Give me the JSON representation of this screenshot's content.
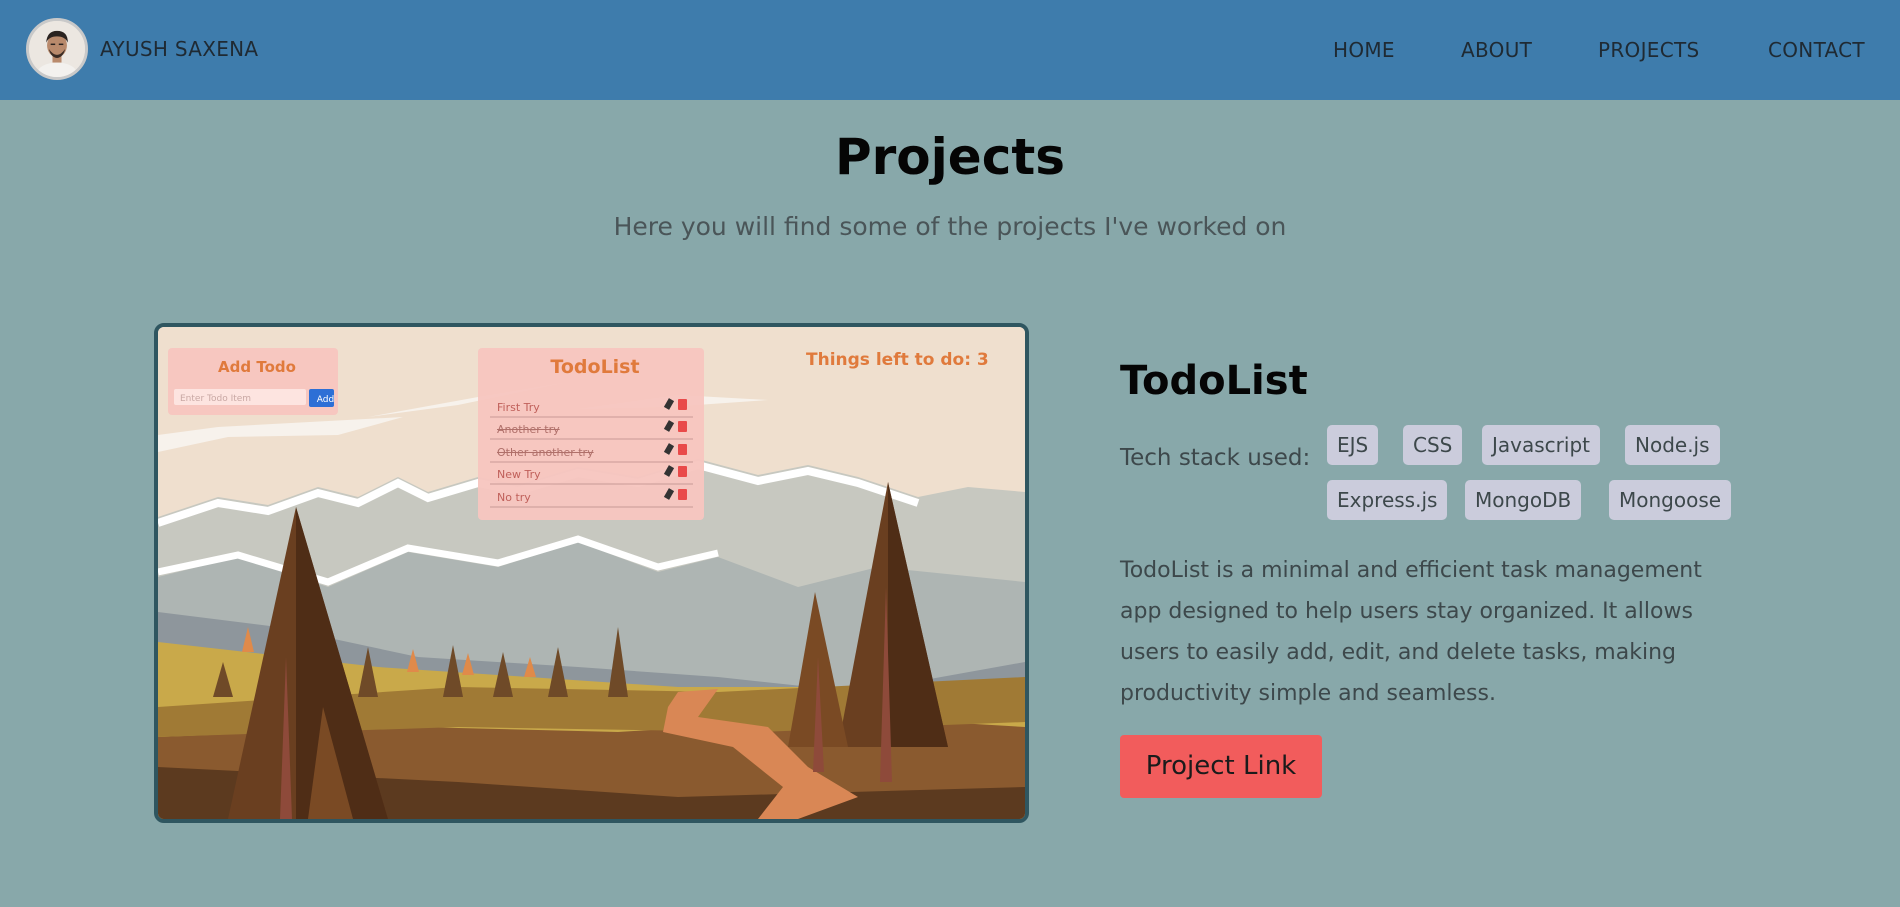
{
  "nav": {
    "brand": "AYUSH SAXENA",
    "links": [
      "HOME",
      "ABOUT",
      "PROJECTS",
      "CONTACT"
    ]
  },
  "page": {
    "title": "Projects",
    "subtitle": "Here you will find some of the projects I've worked on"
  },
  "project": {
    "title": "TodoList",
    "tech_label": "Tech stack used:",
    "tech": [
      "EJS",
      "CSS",
      "Javascript",
      "Node.js",
      "Express.js",
      "MongoDB",
      "Mongoose"
    ],
    "description": "TodoList is a minimal and efficient task management app designed to help users stay organized. It allows users to easily add, edit, and delete tasks, making productivity simple and seamless.",
    "button": "Project Link",
    "screenshot": {
      "add_heading": "Add Todo",
      "input_placeholder": "Enter Todo Item",
      "add_button": "Add",
      "list_heading": "TodoList",
      "counter": "Things left to do: 3",
      "items": [
        {
          "text": "First Try",
          "done": false
        },
        {
          "text": "Another try",
          "done": true
        },
        {
          "text": "Other another try",
          "done": true
        },
        {
          "text": "New Try",
          "done": false
        },
        {
          "text": "No try",
          "done": false
        }
      ]
    }
  },
  "colors": {
    "navbar": "#3e7cac",
    "background": "#88a8aa",
    "tag": "#cbccdc",
    "button": "#f25c5c",
    "todo_accent": "#e07a3c"
  }
}
